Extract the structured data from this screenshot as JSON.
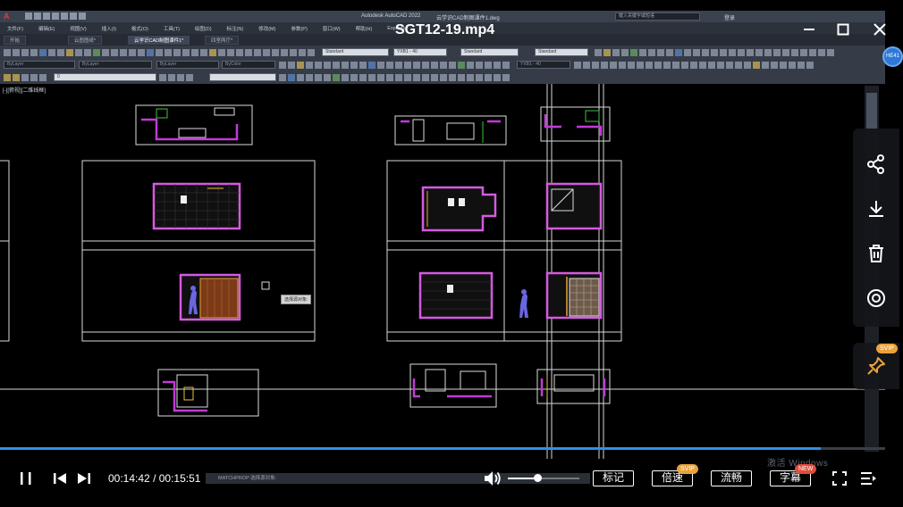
{
  "player": {
    "title": "SGT12-19.mp4",
    "current_time": "00:14:42",
    "duration": "00:15:51",
    "time_separator": "/",
    "progress": 0.927,
    "volume": 0.42,
    "buttons": {
      "mark": "标记",
      "speed": "倍速",
      "quality": "流畅",
      "subtitle": "字幕"
    },
    "badges": {
      "speed_badge": "SVIP",
      "subtitle_badge": "NEW",
      "pin_badge": "SVIP"
    },
    "avatar_text": "HE41",
    "colors": {
      "accent": "#2f8fe8",
      "badge_svip": "#e8a33a",
      "badge_new": "#e24b3b"
    }
  },
  "cad": {
    "app_title": "Autodesk AutoCAD 2022",
    "file_name": "云学识CAD制图课件1.dwg",
    "search_placeholder": "键入关键字或短语",
    "user": "登录",
    "menu": [
      "文件(F)",
      "编辑(E)",
      "视图(V)",
      "插入(I)",
      "格式(O)",
      "工具(T)",
      "绘图(D)",
      "标注(N)",
      "修改(M)",
      "参数(P)",
      "窗口(W)",
      "帮助(H)",
      "Express"
    ],
    "tabs": [
      "开始",
      "云图图纸*",
      "云学识CAD制图课件1*",
      "四室两厅*"
    ],
    "view_label": "[-][俯视][二维线框]",
    "style_boxes": [
      "Standard",
      "YXB1 - 40",
      "Standard",
      "Standard",
      "YXB1 - 40"
    ],
    "layer_boxes": [
      "ByLayer",
      "ByLayer",
      "ByLayer",
      "ByColor"
    ],
    "layer_current": "0",
    "command_prompt": "MATCHPROP 选择源对象:",
    "cursor_tooltip": "选择源对象:",
    "watermark": "激活 Windows"
  }
}
